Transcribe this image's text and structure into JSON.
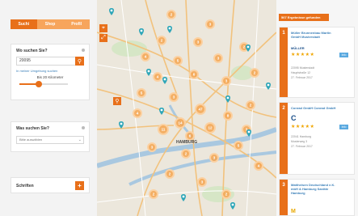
{
  "tabs": [
    {
      "label": "Suchi",
      "active": true
    },
    {
      "label": "Shop",
      "active": false
    },
    {
      "label": "Profil",
      "active": false
    }
  ],
  "search_panel": {
    "title": "Wo suchen Sie?",
    "input_value": "20095",
    "search_icon": "magnifier-icon",
    "link_text": "In meiner Umgebung suchen",
    "radius_label": "Bis 20 Kilometer",
    "radius_fraction": 0.4
  },
  "category_panel": {
    "title": "Was suchen Sie?",
    "select_value": "Bitte auswählen"
  },
  "extra_panel": {
    "title": "Schriften",
    "add_icon": "plus-icon"
  },
  "map": {
    "city_label": "HAMBURG",
    "control_icons": [
      "crosshair-icon",
      "expand-icon"
    ],
    "cluster_counts": [
      "2",
      "3",
      "2",
      "3",
      "4",
      "5",
      "3",
      "2",
      "4",
      "6",
      "3",
      "2",
      "5",
      "3",
      "47",
      "14",
      "12",
      "11",
      "8",
      "2",
      "4",
      "3",
      "2",
      "3",
      "5",
      "4",
      "2",
      "3",
      "2",
      "2",
      "6",
      "3"
    ]
  },
  "results": {
    "header": "507 Ergebnisse gefunden",
    "cards": [
      {
        "number": "1",
        "name": "Müller Brunnenbau Martin GmbH Musterstadt",
        "logo_text": "MÜLLER",
        "stars": "★★★★★",
        "badge": "Info",
        "lines": [
          "22095 Musterstadt",
          "Hauptstraße 12",
          "27. Februar 2017"
        ]
      },
      {
        "number": "2",
        "name": "Conrad GmbH Conrad GmbH",
        "logo_text": "C",
        "stars": "★★★★★",
        "badge": "Info",
        "lines": [
          "22041 Hamburg",
          "Musterweg 3",
          "27. Februar 2017"
        ]
      },
      {
        "number": "3",
        "name": "Mattheisen Deutschland e.K. mbH & Hamburg Sanitär Hamburg",
        "logo_text": "M",
        "stars": "",
        "badge": "",
        "lines": []
      }
    ]
  }
}
